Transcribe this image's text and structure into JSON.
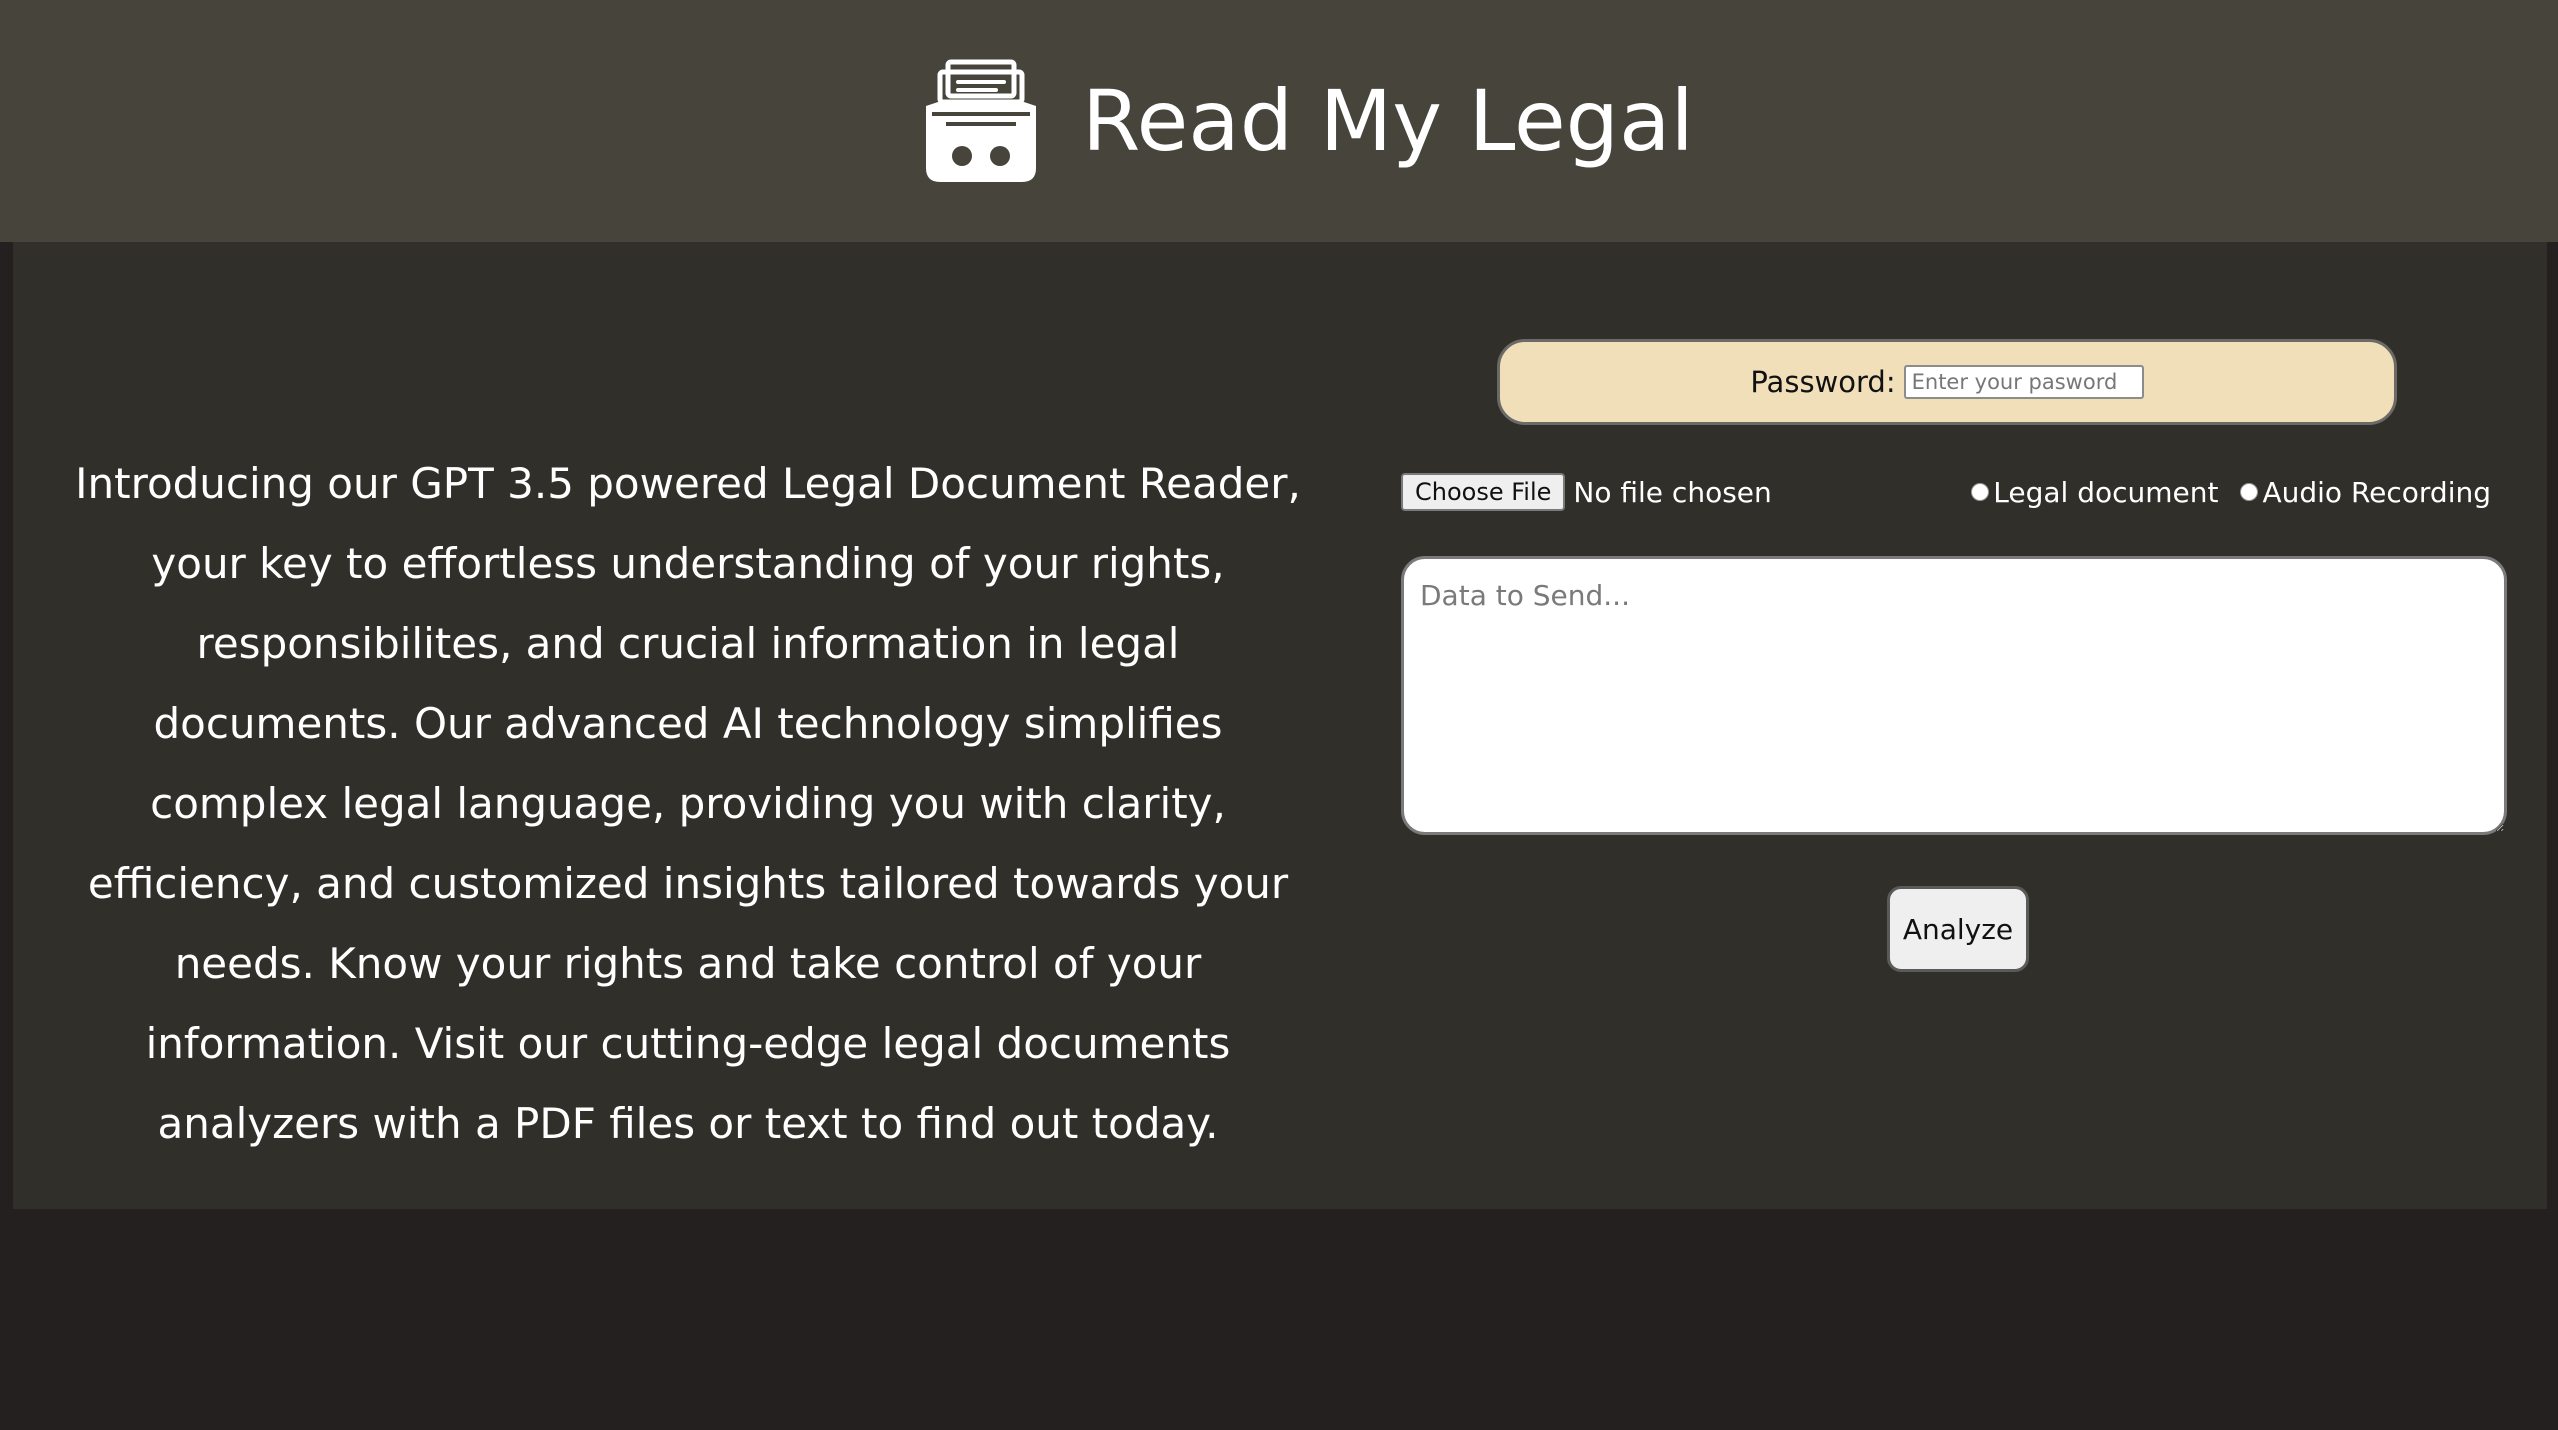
{
  "header": {
    "title": "Read My Legal",
    "logo_icon": "robot-file-cabinet-icon"
  },
  "intro": {
    "text": "Introducing our GPT 3.5 powered Legal Document Reader, your key to effortless understanding of your rights, responsibilites, and crucial information in legal documents. Our advanced AI technology simplifies complex legal language, providing you with clarity, efficiency, and customized insights tailored towards your needs. Know your rights and take control of your information. Visit our cutting-edge legal documents analyzers with a PDF files or text to find out today."
  },
  "form": {
    "password_label": "Password:",
    "password_placeholder": "Enter your pasword",
    "choose_file_label": "Choose File",
    "file_status": "No file chosen",
    "radio_options": [
      {
        "label": "Legal document"
      },
      {
        "label": "Audio Recording"
      }
    ],
    "textarea_placeholder": "Data to Send...",
    "analyze_label": "Analyze"
  },
  "colors": {
    "header_bg": "#47443c",
    "main_bg": "#302f2a",
    "page_bg": "#23201f",
    "password_box_bg": "#f1dfba"
  }
}
